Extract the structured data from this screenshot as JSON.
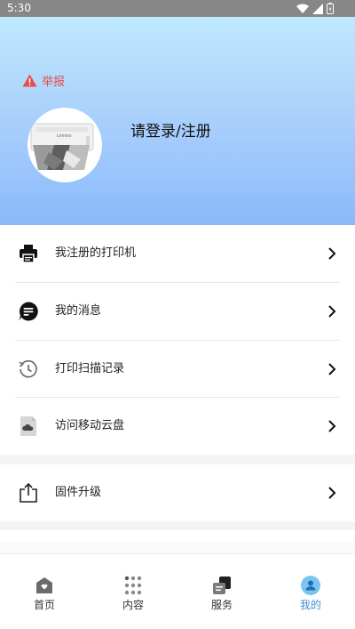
{
  "status_bar": {
    "time": "5:30"
  },
  "header": {
    "report_label": "举报",
    "login_label": "请登录/注册",
    "avatar_brand": "Lenovo"
  },
  "menu": {
    "items": [
      {
        "label": "我注册的打印机",
        "icon": "printer-icon"
      },
      {
        "label": "我的消息",
        "icon": "message-icon"
      },
      {
        "label": "打印扫描记录",
        "icon": "history-icon"
      },
      {
        "label": "访问移动云盘",
        "icon": "cloud-file-icon"
      }
    ],
    "firmware": {
      "label": "固件升级",
      "icon": "share-upload-icon"
    }
  },
  "tabs": [
    {
      "label": "首页",
      "icon": "home-icon",
      "active": false
    },
    {
      "label": "内容",
      "icon": "grid-icon",
      "active": false
    },
    {
      "label": "服务",
      "icon": "service-icon",
      "active": false
    },
    {
      "label": "我的",
      "icon": "profile-icon",
      "active": true
    }
  ],
  "colors": {
    "accent": "#3b8fd8",
    "report": "#e84b4b",
    "header_top": "#bfe9fd",
    "header_bottom": "#8ab9fb"
  }
}
